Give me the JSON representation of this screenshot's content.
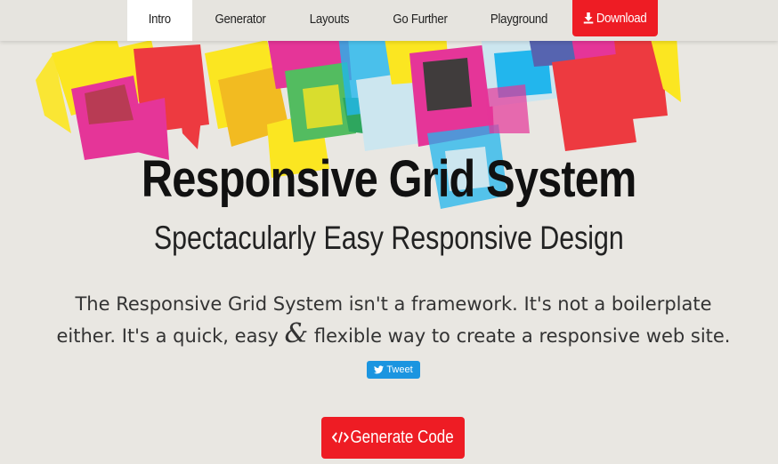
{
  "nav": {
    "items": [
      {
        "label": "Intro",
        "active": true
      },
      {
        "label": "Generator"
      },
      {
        "label": "Layouts"
      },
      {
        "label": "Go Further"
      },
      {
        "label": "Playground"
      }
    ],
    "download_label": "Download",
    "download_icon": "download-icon"
  },
  "hero": {
    "title": "Responsive Grid System",
    "subtitle": "Spectacularly Easy Responsive Design",
    "intro_line1": "The Responsive Grid System isn't a framework. It's not a boilerplate",
    "intro_line2a": "either. It's a quick, easy ",
    "intro_amp": "&",
    "intro_line2b": " flexible way to create a responsive web site."
  },
  "tweet": {
    "label": "Tweet",
    "icon": "twitter-bird-icon",
    "color": "#1b95e0"
  },
  "cta": {
    "label": "Generate Code",
    "icon": "code-icon"
  },
  "colors": {
    "accent": "#ee1c24",
    "yellow": "#ffe600",
    "magenta": "#e5168c",
    "cyan": "#00aeef",
    "green": "#39b54a",
    "dark": "#231f20",
    "background": "#e9e7e2"
  }
}
